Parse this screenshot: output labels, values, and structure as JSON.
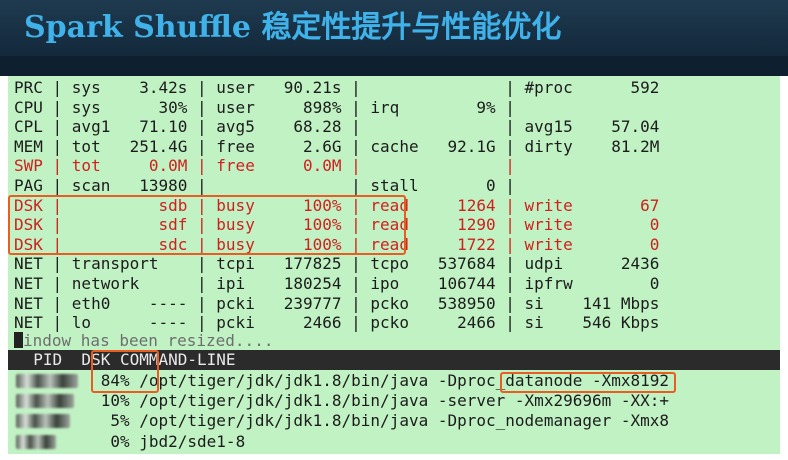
{
  "slide": {
    "title_en": "Spark Shuffle ",
    "title_zh": "稳定性提升与性能优化"
  },
  "terminal": {
    "stat_rows": [
      {
        "cells": [
          "PRC",
          "|",
          "sys",
          "3.42s",
          "|",
          "user",
          "90.21s",
          "|",
          "",
          "",
          "|",
          "#proc",
          "592"
        ]
      },
      {
        "cells": [
          "CPU",
          "|",
          "sys",
          "30%",
          "|",
          "user",
          "898%",
          "|",
          "irq",
          "9%",
          "|",
          "",
          ""
        ]
      },
      {
        "cells": [
          "CPL",
          "|",
          "avg1",
          "71.10",
          "|",
          "avg5",
          "68.28",
          "|",
          "",
          "",
          "|",
          "avg15",
          "57.04"
        ]
      },
      {
        "cells": [
          "MEM",
          "|",
          "tot",
          "251.4G",
          "|",
          "free",
          "2.6G",
          "|",
          "cache",
          "92.1G",
          "|",
          "dirty",
          "81.2M"
        ]
      },
      {
        "cells": [
          "SWP",
          "|",
          "tot",
          "0.0M",
          "|",
          "free",
          "0.0M",
          "|",
          "",
          "",
          "|",
          "",
          ""
        ]
      },
      {
        "cells": [
          "PAG",
          "|",
          "scan",
          "13980",
          "|",
          "",
          "",
          "|",
          "stall",
          "0",
          "|",
          "",
          ""
        ]
      },
      {
        "cells": [
          "DSK",
          "|",
          "",
          "sdb",
          "|",
          "busy",
          "100%",
          "|",
          "read",
          "1264",
          "|",
          "write",
          "67"
        ]
      },
      {
        "cells": [
          "DSK",
          "|",
          "",
          "sdf",
          "|",
          "busy",
          "100%",
          "|",
          "read",
          "1290",
          "|",
          "write",
          "0"
        ]
      },
      {
        "cells": [
          "DSK",
          "|",
          "",
          "sdc",
          "|",
          "busy",
          "100%",
          "|",
          "read",
          "1722",
          "|",
          "write",
          "0"
        ]
      },
      {
        "cells": [
          "NET",
          "|",
          "transport",
          "",
          "|",
          "tcpi",
          "177825",
          "|",
          "tcpo",
          "537684",
          "|",
          "udpi",
          "2436"
        ]
      },
      {
        "cells": [
          "NET",
          "|",
          "network",
          "",
          "|",
          "ipi",
          "180254",
          "|",
          "ipo",
          "106744",
          "|",
          "ipfrw",
          "0"
        ]
      },
      {
        "cells": [
          "NET",
          "|",
          "eth0",
          "----",
          "|",
          "pcki",
          "239777",
          "|",
          "pcko",
          "538950",
          "|",
          "si",
          "141 Mbps"
        ]
      },
      {
        "cells": [
          "NET",
          "|",
          "lo",
          "----",
          "|",
          "pcki",
          "2466",
          "|",
          "pcko",
          "2466",
          "|",
          "si",
          "546 Kbps"
        ]
      }
    ],
    "resize_msg": "indow has been resized....",
    "proc_header": "  PID  DSK COMMAND-LINE",
    "processes": [
      {
        "dsk": "84%",
        "cmd_pre": "/opt/tiger/jdk/jdk1.8/bin/java ",
        "cmd_hl": "-Dproc_datanode",
        "cmd_post": " -Xmx8192"
      },
      {
        "dsk": "10%",
        "cmd_pre": "/opt/tiger/jdk/jdk1.8/bin/java -server -Xmx29696m -XX:+",
        "cmd_hl": "",
        "cmd_post": ""
      },
      {
        "dsk": "5%",
        "cmd_pre": "/opt/tiger/jdk/jdk1.8/bin/java -Dproc_nodemanager -Xmx8",
        "cmd_hl": "",
        "cmd_post": ""
      },
      {
        "dsk": "0%",
        "cmd_pre": "jbd2/sde1-8",
        "cmd_hl": "",
        "cmd_post": ""
      }
    ]
  },
  "colors": {
    "title": "#3fb2ea",
    "terminal_bg": "#c1f2c4",
    "alert_red": "#d0201e",
    "highlight_box": "#ea5d22",
    "header_bg": "#0f2234"
  }
}
